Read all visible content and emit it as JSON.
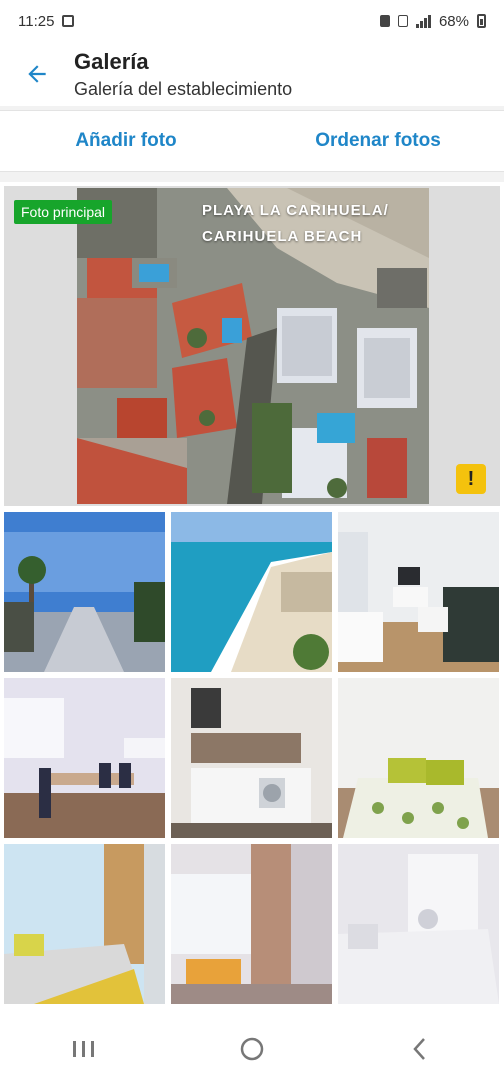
{
  "status": {
    "time": "11:25",
    "battery": "68%"
  },
  "header": {
    "title": "Galería",
    "subtitle": "Galería del establecimiento"
  },
  "actions": {
    "add_photo": "Añadir foto",
    "sort_photos": "Ordenar fotos"
  },
  "main_photo": {
    "badge": "Foto principal",
    "caption_line1": "PLAYA LA CARIHUELA/",
    "caption_line2": "CARIHUELA BEACH",
    "warning": "!"
  },
  "colors": {
    "accent": "#1f86c8",
    "badge_green": "#17a52b",
    "warning_yellow": "#f4c20d"
  },
  "icons": [
    "back-arrow-icon",
    "recents-icon",
    "home-icon",
    "back-nav-icon"
  ]
}
